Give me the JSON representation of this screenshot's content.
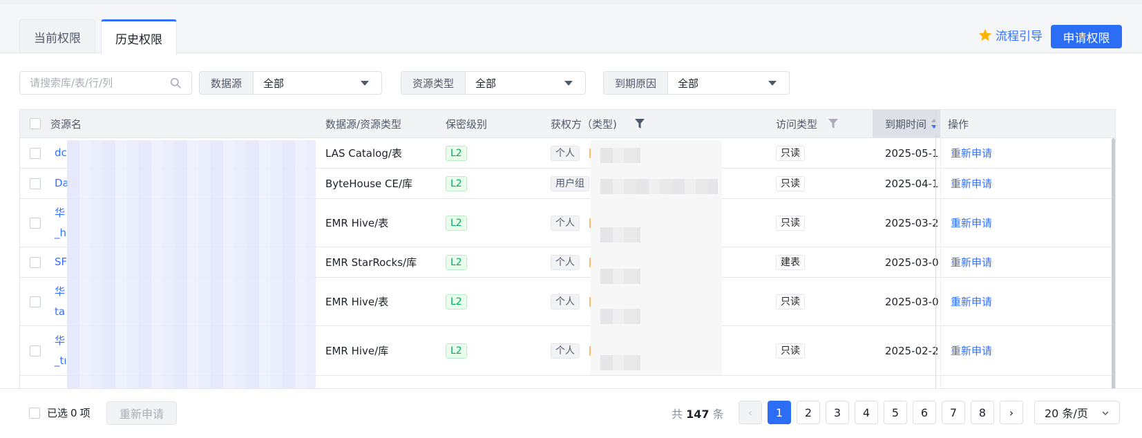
{
  "tabs": [
    {
      "label": "当前权限",
      "active": false
    },
    {
      "label": "历史权限",
      "active": true
    }
  ],
  "header": {
    "guide_label": "流程引导",
    "apply_label": "申请权限"
  },
  "filters": {
    "search_placeholder": "请搜索库/表/行/列",
    "datasource": {
      "label": "数据源",
      "value": "全部"
    },
    "resource_type": {
      "label": "资源类型",
      "value": "全部"
    },
    "expire_reason": {
      "label": "到期原因",
      "value": "全部"
    }
  },
  "table": {
    "columns": {
      "name": "资源名",
      "source_type": "数据源/资源类型",
      "level": "保密级别",
      "grantee": "获权方（类型)",
      "access": "访问类型",
      "expire": "到期时间",
      "action": "操作"
    },
    "rows": [
      {
        "name": "dc",
        "source_type": "LAS Catalog/表",
        "level": "L2",
        "grantee_type": "个人",
        "access": "只读",
        "expire": "2025-05-1",
        "action": "重新申请"
      },
      {
        "name": "Da",
        "source_type": "ByteHouse CE/库",
        "level": "L2",
        "grantee_type": "用户组",
        "access": "只读",
        "expire": "2025-04-1",
        "action": "重新申请"
      },
      {
        "name": "华",
        "name2": "_h",
        "source_type": "EMR Hive/表",
        "level": "L2",
        "grantee_type": "个人",
        "access": "只读",
        "expire": "2025-03-2",
        "action": "重新申请"
      },
      {
        "name": "SF",
        "source_type": "EMR StarRocks/库",
        "level": "L2",
        "grantee_type": "个人",
        "access": "建表",
        "expire": "2025-03-0",
        "action": "重新申请"
      },
      {
        "name": "华",
        "name2": "ta",
        "source_type": "EMR Hive/表",
        "level": "L2",
        "grantee_type": "个人",
        "access": "只读",
        "expire": "2025-03-0",
        "action": "重新申请"
      },
      {
        "name": "华",
        "name2": "_tı",
        "source_type": "EMR Hive/库",
        "level": "L2",
        "grantee_type": "个人",
        "access": "只读",
        "expire": "2025-02-2",
        "action": "重新申请"
      }
    ]
  },
  "footer": {
    "selected_prefix": "已选",
    "selected_count": "0",
    "selected_suffix": "项",
    "reapply_label": "重新申请",
    "total_prefix": "共",
    "total_count": "147",
    "total_suffix": "条",
    "prev": "‹",
    "next": "›",
    "pages": [
      "1",
      "2",
      "3",
      "4",
      "5",
      "6",
      "7",
      "8"
    ],
    "current_page": "1",
    "page_size": "20 条/页"
  },
  "colors": {
    "primary": "#2b6ef5",
    "link": "#3370ff",
    "tag_l2": "#00a870",
    "star": "#ffb400"
  },
  "icons": [
    "star-icon",
    "search-icon",
    "caret-down-icon",
    "filter-icon",
    "sort-icon",
    "chevron-left-icon",
    "chevron-right-icon",
    "chevron-down-icon"
  ]
}
